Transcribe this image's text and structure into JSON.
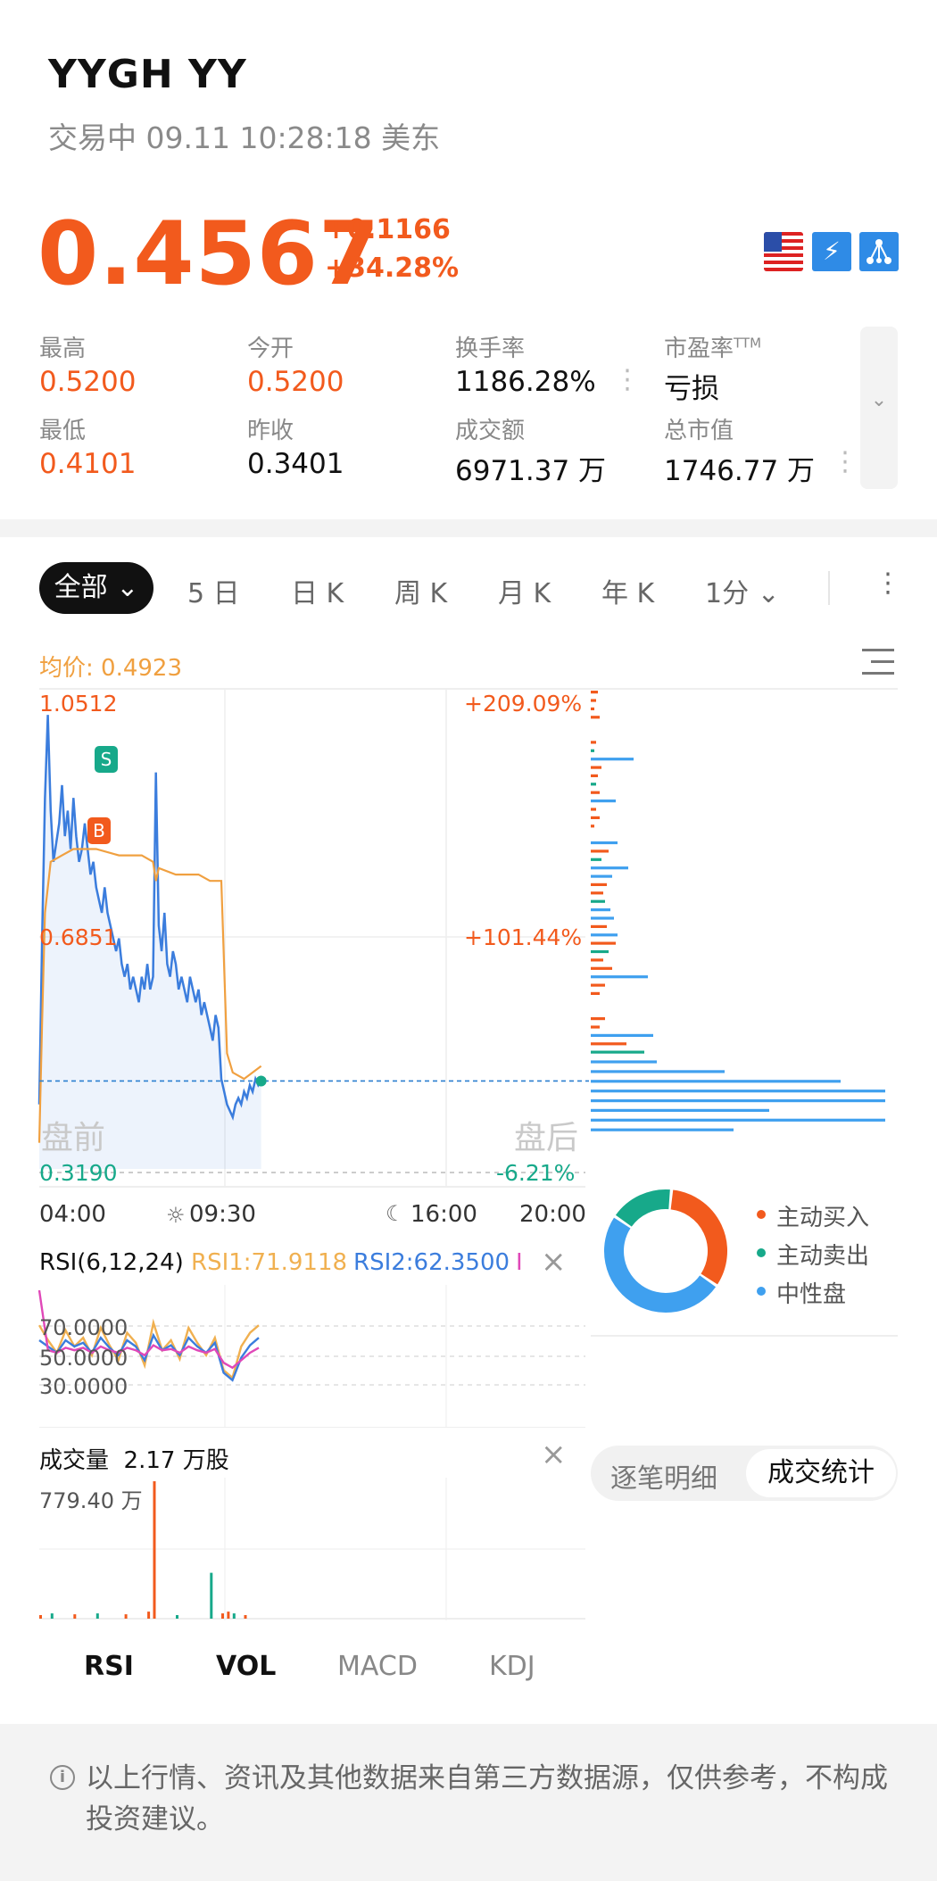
{
  "header": {
    "ticker": "YYGH YY",
    "status": "交易中 09.11 10:28:18 美东",
    "price": "0.4567",
    "change": "+0.1166",
    "change_pct": "+34.28%",
    "bolt_glyph": "⚡"
  },
  "stats": {
    "high_label": "最高",
    "high_value": "0.5200",
    "open_label": "今开",
    "open_value": "0.5200",
    "turnover_label": "换手率",
    "turnover_value": "1186.28%",
    "pe_label": "市盈率",
    "pe_sup": "TTM",
    "pe_value": "亏损",
    "low_label": "最低",
    "low_value": "0.4101",
    "prev_close_label": "昨收",
    "prev_close_value": "0.3401",
    "amount_label": "成交额",
    "amount_value": "6971.37 万",
    "mktcap_label": "总市值",
    "mktcap_value": "1746.77 万",
    "more_glyph": "⋮",
    "expand_glyph": "⌄"
  },
  "tabs": {
    "all": "全部 ⌄",
    "d5": "5 日",
    "day_k": "日 K",
    "week_k": "周 K",
    "month_k": "月 K",
    "year_k": "年 K",
    "interval": "1分 ⌄",
    "more": "⋮"
  },
  "chart": {
    "avg_label": "均价: 0.4923",
    "y_top": "1.0512",
    "y_mid": "0.6851",
    "y_bottom": "0.3190",
    "pct_top": "+209.09%",
    "pct_mid": "+101.44%",
    "pct_bottom": "-6.21%",
    "premarket": "盘前",
    "afterhours": "盘后",
    "t0": "04:00",
    "t1": "09:30",
    "t2": "16:00",
    "t3": "20:00",
    "sell_marker": "S",
    "buy_marker": "B",
    "colors": {
      "price": "#3b7ddd",
      "avg": "#f0a040",
      "up": "#f25a1d",
      "down": "#17a98a",
      "neutral": "#3fa0ef"
    }
  },
  "chart_data": {
    "type": "line",
    "title": "",
    "xlabel": "",
    "ylabel": "",
    "x_ticks": [
      "04:00",
      "09:30",
      "16:00",
      "20:00"
    ],
    "ylim": [
      0.319,
      1.0512
    ],
    "series": [
      {
        "name": "",
        "x_minutes_from_0400": [
          0,
          5,
          10,
          15,
          20,
          25,
          30,
          35,
          40,
          45,
          50,
          55,
          60,
          65,
          70,
          75,
          80,
          85,
          90,
          95,
          100,
          105,
          110,
          115,
          120,
          125,
          130,
          135,
          140,
          145,
          150,
          155,
          160,
          165,
          170,
          175,
          180,
          185,
          190,
          195,
          200,
          205,
          210,
          215,
          220,
          225,
          230,
          235,
          240,
          245,
          250,
          255,
          260,
          265,
          270,
          275,
          280,
          285,
          290,
          295,
          300,
          305,
          310,
          315,
          320,
          325,
          330,
          335,
          340,
          345,
          350,
          355,
          360,
          365,
          370,
          375,
          380,
          385,
          390
        ],
        "values": [
          0.42,
          0.68,
          0.9,
          1.03,
          0.88,
          0.8,
          0.83,
          0.86,
          0.92,
          0.84,
          0.88,
          0.82,
          0.9,
          0.84,
          0.8,
          0.82,
          0.86,
          0.82,
          0.78,
          0.8,
          0.76,
          0.74,
          0.72,
          0.76,
          0.72,
          0.7,
          0.68,
          0.66,
          0.68,
          0.64,
          0.62,
          0.64,
          0.6,
          0.62,
          0.6,
          0.58,
          0.62,
          0.6,
          0.64,
          0.6,
          0.62,
          0.94,
          0.7,
          0.66,
          0.72,
          0.64,
          0.62,
          0.66,
          0.64,
          0.6,
          0.62,
          0.6,
          0.58,
          0.62,
          0.6,
          0.58,
          0.6,
          0.56,
          0.58,
          0.56,
          0.54,
          0.52,
          0.56,
          0.54,
          0.46,
          0.44,
          0.42,
          0.41,
          0.4,
          0.42,
          0.43,
          0.42,
          0.44,
          0.43,
          0.45,
          0.44,
          0.46,
          0.45,
          0.4567
        ]
      },
      {
        "name": "",
        "x_minutes_from_0400": [
          0,
          5,
          10,
          20,
          40,
          60,
          100,
          140,
          180,
          200,
          205,
          210,
          240,
          280,
          300,
          320,
          330,
          340,
          360,
          390
        ],
        "values": [
          0.36,
          0.55,
          0.72,
          0.8,
          0.81,
          0.82,
          0.82,
          0.81,
          0.81,
          0.8,
          0.77,
          0.79,
          0.78,
          0.78,
          0.77,
          0.77,
          0.5,
          0.47,
          0.46,
          0.48
        ]
      }
    ]
  },
  "volume_profile": [
    {
      "w": 8,
      "c": "up"
    },
    {
      "w": 6,
      "c": "up"
    },
    {
      "w": 4,
      "c": "up"
    },
    {
      "w": 10,
      "c": "up"
    },
    {
      "w": 0,
      "c": "up"
    },
    {
      "w": 0,
      "c": "up"
    },
    {
      "w": 6,
      "c": "up"
    },
    {
      "w": 4,
      "c": "down"
    },
    {
      "w": 48,
      "c": "neutral"
    },
    {
      "w": 12,
      "c": "up"
    },
    {
      "w": 8,
      "c": "up"
    },
    {
      "w": 6,
      "c": "down"
    },
    {
      "w": 10,
      "c": "up"
    },
    {
      "w": 28,
      "c": "neutral"
    },
    {
      "w": 6,
      "c": "up"
    },
    {
      "w": 10,
      "c": "up"
    },
    {
      "w": 4,
      "c": "up"
    },
    {
      "w": 0,
      "c": "up"
    },
    {
      "w": 30,
      "c": "neutral"
    },
    {
      "w": 20,
      "c": "up"
    },
    {
      "w": 12,
      "c": "down"
    },
    {
      "w": 42,
      "c": "neutral"
    },
    {
      "w": 24,
      "c": "neutral"
    },
    {
      "w": 18,
      "c": "up"
    },
    {
      "w": 14,
      "c": "up"
    },
    {
      "w": 16,
      "c": "down"
    },
    {
      "w": 22,
      "c": "neutral"
    },
    {
      "w": 26,
      "c": "neutral"
    },
    {
      "w": 18,
      "c": "up"
    },
    {
      "w": 30,
      "c": "neutral"
    },
    {
      "w": 28,
      "c": "up"
    },
    {
      "w": 20,
      "c": "down"
    },
    {
      "w": 14,
      "c": "up"
    },
    {
      "w": 24,
      "c": "up"
    },
    {
      "w": 64,
      "c": "neutral"
    },
    {
      "w": 16,
      "c": "up"
    },
    {
      "w": 10,
      "c": "up"
    },
    {
      "w": 0,
      "c": "up"
    },
    {
      "w": 0,
      "c": "up"
    },
    {
      "w": 16,
      "c": "up"
    },
    {
      "w": 10,
      "c": "up"
    },
    {
      "w": 70,
      "c": "neutral"
    },
    {
      "w": 40,
      "c": "up"
    },
    {
      "w": 60,
      "c": "down"
    },
    {
      "w": 74,
      "c": "neutral"
    },
    {
      "w": 150,
      "c": "neutral"
    },
    {
      "w": 280,
      "c": "neutral"
    },
    {
      "w": 330,
      "c": "neutral"
    },
    {
      "w": 330,
      "c": "neutral"
    },
    {
      "w": 200,
      "c": "neutral"
    },
    {
      "w": 330,
      "c": "neutral"
    },
    {
      "w": 160,
      "c": "neutral"
    }
  ],
  "donut": {
    "buy_label": "主动买入",
    "sell_label": "主动卖出",
    "neutral_label": "中性盘",
    "buy_share": 0.33,
    "sell_share": 0.17,
    "neutral_share": 0.5
  },
  "detail_tabs": {
    "detail": "逐笔明细",
    "stats": "成交统计"
  },
  "rsi": {
    "title": "RSI(6,12,24)",
    "rsi1": "RSI1:71.9118",
    "rsi2": "RSI2:62.3500",
    "rsi3": "I",
    "close": "×",
    "level_70": "70.0000",
    "level_50": "50.0000",
    "level_30": "30.0000",
    "colors": {
      "rsi1": "#f0b050",
      "rsi2": "#3b7ddd",
      "rsi3": "#e048b8"
    }
  },
  "rsi_data": {
    "rsi1": [
      72,
      60,
      50,
      68,
      55,
      62,
      48,
      70,
      56,
      44,
      66,
      58,
      40,
      74,
      52,
      60,
      45,
      70,
      58,
      48,
      62,
      36,
      30,
      55,
      66,
      72
    ],
    "rsi2": [
      60,
      55,
      50,
      60,
      55,
      58,
      50,
      62,
      54,
      48,
      60,
      55,
      44,
      64,
      52,
      56,
      48,
      62,
      55,
      50,
      58,
      34,
      28,
      46,
      56,
      62
    ],
    "rsi3": [
      100,
      52,
      50,
      54,
      52,
      54,
      50,
      55,
      52,
      50,
      54,
      52,
      48,
      56,
      52,
      53,
      50,
      55,
      52,
      50,
      53,
      42,
      38,
      44,
      50,
      54
    ]
  },
  "volume": {
    "title": "成交量",
    "value": "2.17 万股",
    "max_label": "779.40 万",
    "close": "×"
  },
  "volume_data": {
    "x_minutes_from_0400": [
      0,
      20,
      60,
      100,
      150,
      190,
      200,
      240,
      300,
      320,
      330,
      340,
      360
    ],
    "values": [
      20,
      30,
      25,
      30,
      25,
      40,
      779.4,
      20,
      260,
      30,
      40,
      30,
      20
    ],
    "colors": [
      "up",
      "down",
      "up",
      "down",
      "up",
      "up",
      "up",
      "down",
      "down",
      "up",
      "up",
      "down",
      "up"
    ]
  },
  "bottom_tabs": {
    "rsi": "RSI",
    "vol": "VOL",
    "macd": "MACD",
    "kdj": "KDJ"
  },
  "footer": {
    "icon": "i",
    "text": "以上行情、资讯及其他数据来自第三方数据源，仅供参考，不构成投资建议。"
  }
}
